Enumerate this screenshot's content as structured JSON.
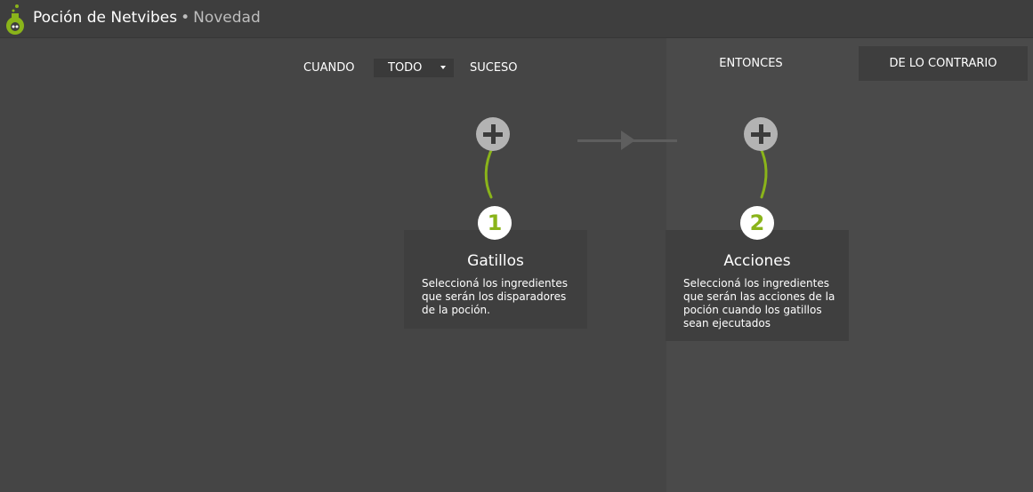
{
  "app": {
    "title": "Poción de Netvibes",
    "separator": "•",
    "subtitle": "Novedad",
    "logo_icon": "potion-flask-icon"
  },
  "condition": {
    "when_label": "CUANDO",
    "selected": "TODO",
    "event_label": "SUCESO"
  },
  "then_header": "ENTONCES",
  "else_button": "DE LO CONTRARIO",
  "triggers": {
    "step": "1",
    "title": "Gatillos",
    "description": "Seleccioná los ingredientes que serán los disparadores de la poción."
  },
  "actions": {
    "step": "2",
    "title": "Acciones",
    "description": "Seleccioná los ingredientes que serán las acciones de la poción cuando los gatillos sean ejecutados"
  },
  "colors": {
    "background": "#454545",
    "header": "#3e3e3e",
    "card": "#3f3f3f",
    "accent_green": "#8ab41a",
    "plus_button": "#b3b3b3"
  }
}
